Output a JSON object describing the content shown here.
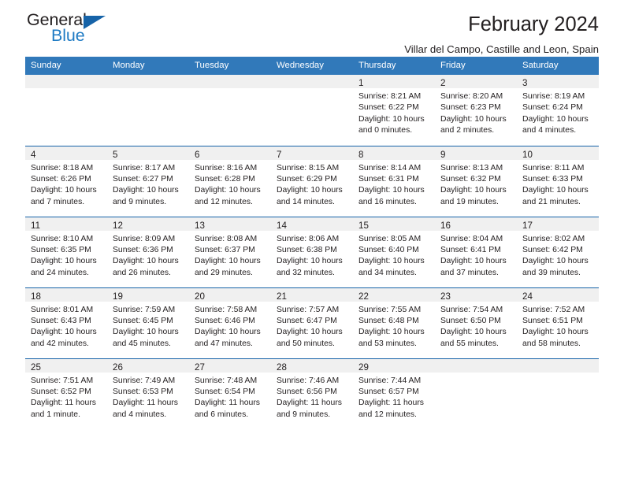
{
  "brand": {
    "name_part1": "General",
    "name_part2": "Blue",
    "accent_color": "#1f7bc4",
    "triangle_color": "#1663a8"
  },
  "header": {
    "title": "February 2024",
    "subtitle": "Villar del Campo, Castille and Leon, Spain"
  },
  "calendar": {
    "header_bg": "#3179ba",
    "daynum_band_bg": "#f0f0f0",
    "row_border_color": "#1663a8",
    "weekdays": [
      "Sunday",
      "Monday",
      "Tuesday",
      "Wednesday",
      "Thursday",
      "Friday",
      "Saturday"
    ],
    "weeks": [
      [
        {
          "day": "",
          "sunrise": "",
          "sunset": "",
          "daylight": "",
          "empty": true
        },
        {
          "day": "",
          "sunrise": "",
          "sunset": "",
          "daylight": "",
          "empty": true
        },
        {
          "day": "",
          "sunrise": "",
          "sunset": "",
          "daylight": "",
          "empty": true
        },
        {
          "day": "",
          "sunrise": "",
          "sunset": "",
          "daylight": "",
          "empty": true
        },
        {
          "day": "1",
          "sunrise": "Sunrise: 8:21 AM",
          "sunset": "Sunset: 6:22 PM",
          "daylight": "Daylight: 10 hours and 0 minutes."
        },
        {
          "day": "2",
          "sunrise": "Sunrise: 8:20 AM",
          "sunset": "Sunset: 6:23 PM",
          "daylight": "Daylight: 10 hours and 2 minutes."
        },
        {
          "day": "3",
          "sunrise": "Sunrise: 8:19 AM",
          "sunset": "Sunset: 6:24 PM",
          "daylight": "Daylight: 10 hours and 4 minutes."
        }
      ],
      [
        {
          "day": "4",
          "sunrise": "Sunrise: 8:18 AM",
          "sunset": "Sunset: 6:26 PM",
          "daylight": "Daylight: 10 hours and 7 minutes."
        },
        {
          "day": "5",
          "sunrise": "Sunrise: 8:17 AM",
          "sunset": "Sunset: 6:27 PM",
          "daylight": "Daylight: 10 hours and 9 minutes."
        },
        {
          "day": "6",
          "sunrise": "Sunrise: 8:16 AM",
          "sunset": "Sunset: 6:28 PM",
          "daylight": "Daylight: 10 hours and 12 minutes."
        },
        {
          "day": "7",
          "sunrise": "Sunrise: 8:15 AM",
          "sunset": "Sunset: 6:29 PM",
          "daylight": "Daylight: 10 hours and 14 minutes."
        },
        {
          "day": "8",
          "sunrise": "Sunrise: 8:14 AM",
          "sunset": "Sunset: 6:31 PM",
          "daylight": "Daylight: 10 hours and 16 minutes."
        },
        {
          "day": "9",
          "sunrise": "Sunrise: 8:13 AM",
          "sunset": "Sunset: 6:32 PM",
          "daylight": "Daylight: 10 hours and 19 minutes."
        },
        {
          "day": "10",
          "sunrise": "Sunrise: 8:11 AM",
          "sunset": "Sunset: 6:33 PM",
          "daylight": "Daylight: 10 hours and 21 minutes."
        }
      ],
      [
        {
          "day": "11",
          "sunrise": "Sunrise: 8:10 AM",
          "sunset": "Sunset: 6:35 PM",
          "daylight": "Daylight: 10 hours and 24 minutes."
        },
        {
          "day": "12",
          "sunrise": "Sunrise: 8:09 AM",
          "sunset": "Sunset: 6:36 PM",
          "daylight": "Daylight: 10 hours and 26 minutes."
        },
        {
          "day": "13",
          "sunrise": "Sunrise: 8:08 AM",
          "sunset": "Sunset: 6:37 PM",
          "daylight": "Daylight: 10 hours and 29 minutes."
        },
        {
          "day": "14",
          "sunrise": "Sunrise: 8:06 AM",
          "sunset": "Sunset: 6:38 PM",
          "daylight": "Daylight: 10 hours and 32 minutes."
        },
        {
          "day": "15",
          "sunrise": "Sunrise: 8:05 AM",
          "sunset": "Sunset: 6:40 PM",
          "daylight": "Daylight: 10 hours and 34 minutes."
        },
        {
          "day": "16",
          "sunrise": "Sunrise: 8:04 AM",
          "sunset": "Sunset: 6:41 PM",
          "daylight": "Daylight: 10 hours and 37 minutes."
        },
        {
          "day": "17",
          "sunrise": "Sunrise: 8:02 AM",
          "sunset": "Sunset: 6:42 PM",
          "daylight": "Daylight: 10 hours and 39 minutes."
        }
      ],
      [
        {
          "day": "18",
          "sunrise": "Sunrise: 8:01 AM",
          "sunset": "Sunset: 6:43 PM",
          "daylight": "Daylight: 10 hours and 42 minutes."
        },
        {
          "day": "19",
          "sunrise": "Sunrise: 7:59 AM",
          "sunset": "Sunset: 6:45 PM",
          "daylight": "Daylight: 10 hours and 45 minutes."
        },
        {
          "day": "20",
          "sunrise": "Sunrise: 7:58 AM",
          "sunset": "Sunset: 6:46 PM",
          "daylight": "Daylight: 10 hours and 47 minutes."
        },
        {
          "day": "21",
          "sunrise": "Sunrise: 7:57 AM",
          "sunset": "Sunset: 6:47 PM",
          "daylight": "Daylight: 10 hours and 50 minutes."
        },
        {
          "day": "22",
          "sunrise": "Sunrise: 7:55 AM",
          "sunset": "Sunset: 6:48 PM",
          "daylight": "Daylight: 10 hours and 53 minutes."
        },
        {
          "day": "23",
          "sunrise": "Sunrise: 7:54 AM",
          "sunset": "Sunset: 6:50 PM",
          "daylight": "Daylight: 10 hours and 55 minutes."
        },
        {
          "day": "24",
          "sunrise": "Sunrise: 7:52 AM",
          "sunset": "Sunset: 6:51 PM",
          "daylight": "Daylight: 10 hours and 58 minutes."
        }
      ],
      [
        {
          "day": "25",
          "sunrise": "Sunrise: 7:51 AM",
          "sunset": "Sunset: 6:52 PM",
          "daylight": "Daylight: 11 hours and 1 minute."
        },
        {
          "day": "26",
          "sunrise": "Sunrise: 7:49 AM",
          "sunset": "Sunset: 6:53 PM",
          "daylight": "Daylight: 11 hours and 4 minutes."
        },
        {
          "day": "27",
          "sunrise": "Sunrise: 7:48 AM",
          "sunset": "Sunset: 6:54 PM",
          "daylight": "Daylight: 11 hours and 6 minutes."
        },
        {
          "day": "28",
          "sunrise": "Sunrise: 7:46 AM",
          "sunset": "Sunset: 6:56 PM",
          "daylight": "Daylight: 11 hours and 9 minutes."
        },
        {
          "day": "29",
          "sunrise": "Sunrise: 7:44 AM",
          "sunset": "Sunset: 6:57 PM",
          "daylight": "Daylight: 11 hours and 12 minutes."
        },
        {
          "day": "",
          "sunrise": "",
          "sunset": "",
          "daylight": "",
          "empty": true
        },
        {
          "day": "",
          "sunrise": "",
          "sunset": "",
          "daylight": "",
          "empty": true
        }
      ]
    ]
  }
}
